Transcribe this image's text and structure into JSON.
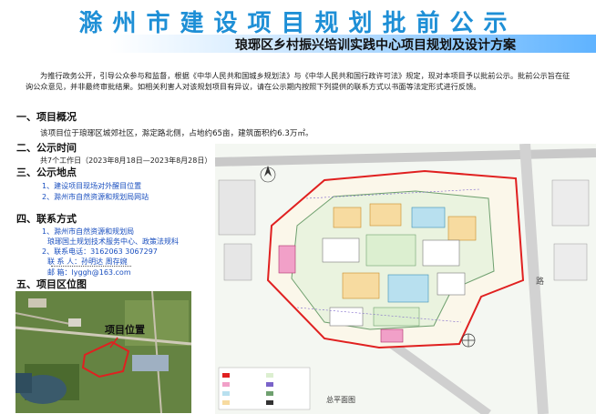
{
  "header": {
    "main_title": "滁州市建设项目规划批前公示",
    "sub_title": "琅琊区乡村振兴培训实践中心项目规划及设计方案"
  },
  "intro": "为推行政务公开，引导公众参与和监督，根据《中华人民共和国城乡规划法》与《中华人民共和国行政许可法》规定，现对本项目予以批前公示。批前公示旨在征询公众意见，并非最终审批结果。如相关利害人对该规划项目有异议，请在公示期内按照下列提供的联系方式以书面等法定形式进行反馈。",
  "sections": {
    "overview": {
      "heading": "一、项目概况",
      "text": "该项目位于琅琊区城郊社区，滁定路北侧，占地约65亩，建筑面积约6.3万㎡。"
    },
    "period": {
      "heading": "二、公示时间",
      "text": "共7个工作日（2023年8月18日—2023年8月28日）"
    },
    "place": {
      "heading": "三、公示地点",
      "items": [
        "1、建设项目现场对外醒目位置",
        "2、滁州市自然资源和规划局网站"
      ]
    },
    "contact": {
      "heading": "四、联系方式",
      "lines": [
        "1、滁州市自然资源和规划局",
        "琅琊国土规划技术服务中心、政策法规科",
        "2、联系电话：3162063  3067297",
        "联 系 人：孙明达    周存婉",
        "邮    箱：lyggh@163.com"
      ]
    },
    "location": {
      "heading": "五、项目区位图",
      "map_label": "项目位置"
    }
  },
  "plan": {
    "caption": "总平面图",
    "road_label": "路"
  },
  "colors": {
    "title_blue": "#1e8fd6",
    "site_boundary": "#e02020",
    "section_blue": "#1a4fbf"
  }
}
